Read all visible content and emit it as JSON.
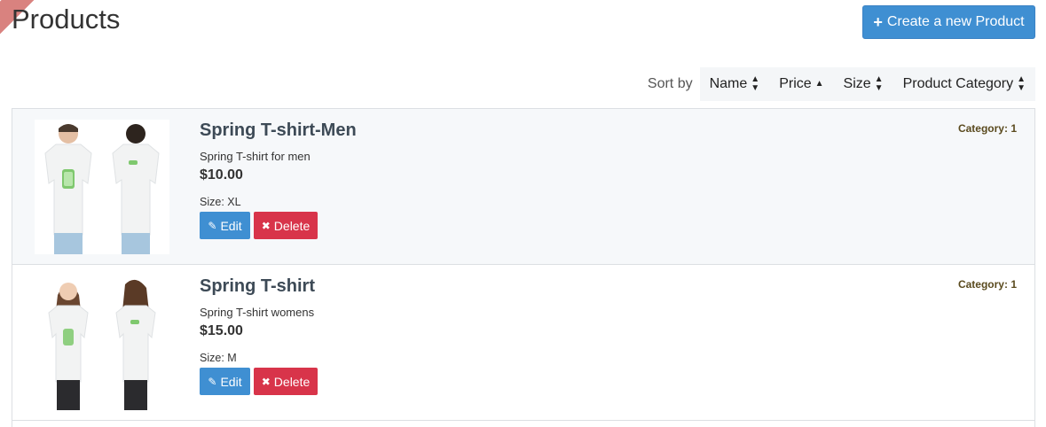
{
  "header": {
    "title": "Products",
    "create_button_label": "Create a new Product"
  },
  "sort": {
    "label": "Sort by",
    "options": [
      {
        "label": "Name",
        "direction": "both"
      },
      {
        "label": "Price",
        "direction": "asc"
      },
      {
        "label": "Size",
        "direction": "both"
      },
      {
        "label": "Product Category",
        "direction": "both"
      }
    ]
  },
  "products": [
    {
      "name": "Spring T-shirt-Men",
      "description": "Spring T-shirt for men",
      "price": "$10.00",
      "size": "Size: XL",
      "category": "Category: 1",
      "image": "men-tshirt-photo",
      "edit_label": "Edit",
      "delete_label": "Delete"
    },
    {
      "name": "Spring T-shirt",
      "description": "Spring T-shirt womens",
      "price": "$15.00",
      "size": "Size: M",
      "category": "Category: 1",
      "image": "women-tshirt-photo",
      "edit_label": "Edit",
      "delete_label": "Delete"
    }
  ],
  "colors": {
    "primary": "#3f8fd2",
    "danger": "#d8344a",
    "category_text": "#5a4a1e",
    "ribbon": "#d9827f"
  }
}
